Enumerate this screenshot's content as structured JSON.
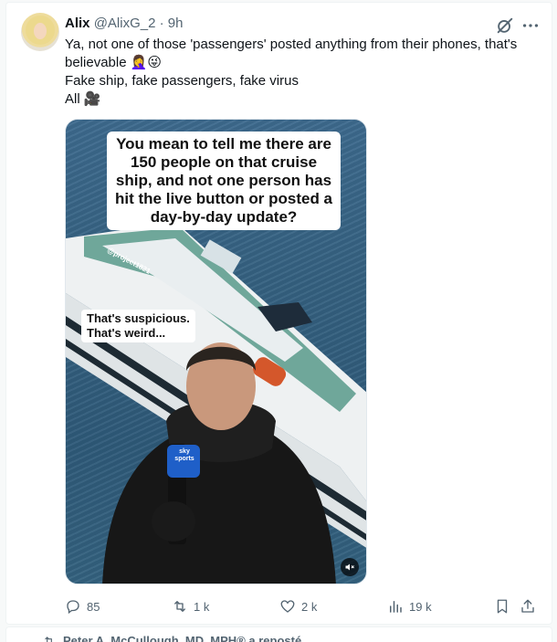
{
  "post": {
    "author_name": "Alix",
    "author_handle": "@AlixG_2",
    "separator": "·",
    "time": "9h",
    "text_lines": [
      "Ya, not one of those 'passengers' posted anything from their phones, that's",
      "believable 🤦‍♀️😜",
      "Fake ship, fake passengers, fake virus",
      "All 🎥"
    ],
    "media": {
      "caption": "You mean to tell me there are 150 people on that cruise ship, and not one person has hit the live button or posted a day-by-day update?",
      "watermark": "@project1821",
      "side_caption_line1": "That's suspicious.",
      "side_caption_line2": "That's weird...",
      "mic_flag_line1": "sky",
      "mic_flag_line2": "sports"
    },
    "actions": {
      "replies": "85",
      "reposts": "1 k",
      "likes": "2 k",
      "views": "19 k"
    },
    "icons": [
      "grok-icon",
      "more-icon",
      "reply-icon",
      "repost-icon",
      "like-icon",
      "views-icon",
      "bookmark-icon",
      "share-icon",
      "mute-icon"
    ]
  },
  "next_post": {
    "repost_text": "Peter A. McCullough, MD, MPH® a reposté"
  },
  "colors": {
    "text": "#0f1419",
    "muted": "#536471",
    "border": "#eff3f4"
  }
}
